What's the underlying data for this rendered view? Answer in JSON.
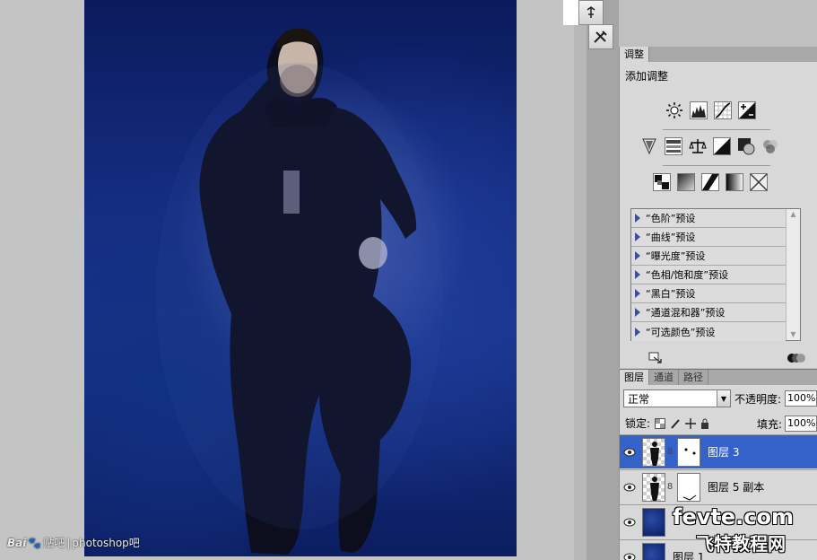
{
  "adjustments_panel": {
    "tab": "调整",
    "title": "添加调整",
    "presets": [
      "“色阶”预设",
      "“曲线”预设",
      "“曝光度”预设",
      "“色相/饱和度”预设",
      "“黑白”预设",
      "“通道混和器”预设",
      "“可选颜色”预设"
    ]
  },
  "layers_panel": {
    "tabs": [
      "图层",
      "通道",
      "路径"
    ],
    "blend_mode": "正常",
    "opacity_label": "不透明度:",
    "opacity": "100%",
    "lock_label": "锁定:",
    "fill_label": "填充:",
    "fill": "100%",
    "layers": [
      {
        "name": "图层 3",
        "selected": true
      },
      {
        "name": "图层 5 副本",
        "selected": false
      },
      {
        "name": "",
        "selected": false
      },
      {
        "name": "图层 1",
        "selected": false
      }
    ]
  },
  "watermarks": {
    "baidu": "Bai",
    "baidu_suffix": "贴吧",
    "forum": "photoshop吧",
    "site": "fevte.com",
    "site_cn": "飞特教程网"
  },
  "colors": {
    "selection": "#3462c8",
    "photo_blue": "#17338a"
  }
}
